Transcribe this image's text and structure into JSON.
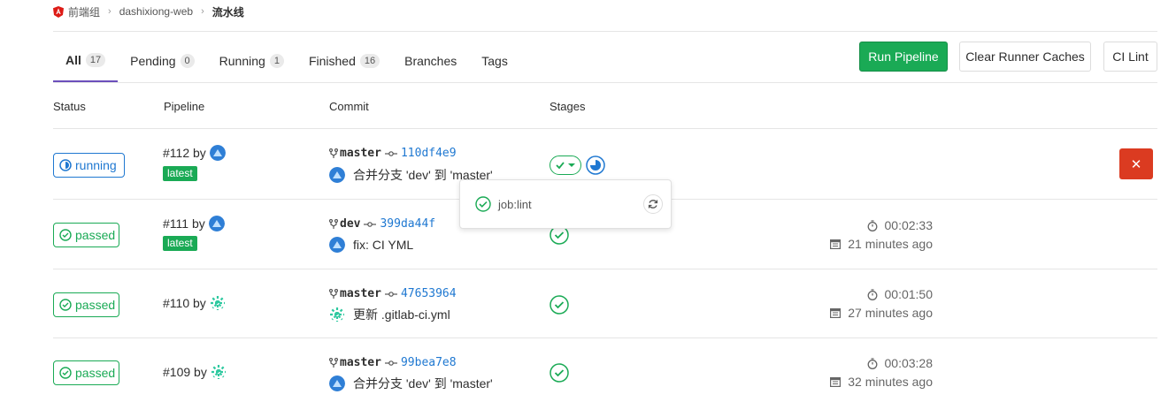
{
  "breadcrumb": {
    "group": "前端组",
    "project": "dashixiong-web",
    "page": "流水线"
  },
  "tabs": [
    {
      "label": "All",
      "count": "17"
    },
    {
      "label": "Pending",
      "count": "0"
    },
    {
      "label": "Running",
      "count": "1"
    },
    {
      "label": "Finished",
      "count": "16"
    },
    {
      "label": "Branches",
      "count": ""
    },
    {
      "label": "Tags",
      "count": ""
    }
  ],
  "actions": {
    "run": "Run Pipeline",
    "clear": "Clear Runner Caches",
    "lint": "CI Lint"
  },
  "columns": {
    "status": "Status",
    "pipeline": "Pipeline",
    "commit": "Commit",
    "stages": "Stages"
  },
  "pipelines": [
    {
      "status": "running",
      "id": "#112 by",
      "latest": "latest",
      "branch": "master",
      "sha": "110df4e9",
      "message": "合并分支 'dev' 到 'master'",
      "duration": "",
      "finished": ""
    },
    {
      "status": "passed",
      "id": "#111 by",
      "latest": "latest",
      "branch": "dev",
      "sha": "399da44f",
      "message": "fix: CI YML",
      "duration": "00:02:33",
      "finished": "21 minutes ago"
    },
    {
      "status": "passed",
      "id": "#110 by",
      "latest": "",
      "branch": "master",
      "sha": "47653964",
      "message": "更新 .gitlab-ci.yml",
      "duration": "00:01:50",
      "finished": "27 minutes ago"
    },
    {
      "status": "passed",
      "id": "#109 by",
      "latest": "",
      "branch": "master",
      "sha": "99bea7e8",
      "message": "合并分支 'dev' 到 'master'",
      "duration": "00:03:28",
      "finished": "32 minutes ago"
    }
  ],
  "popover": {
    "job": "job:lint"
  },
  "colors": {
    "success": "#1aaa55",
    "running": "#1f78d1",
    "danger": "#db3b21",
    "active_tab": "#6b4fbb"
  },
  "icons": {
    "status_running": "running-circle-icon",
    "status_passed": "check-circle-icon",
    "branch": "branch-fork-icon",
    "commit": "commit-dot-icon",
    "timer": "stopwatch-icon",
    "calendar": "calendar-icon",
    "retry": "retry-icon",
    "cancel": "close-icon"
  }
}
